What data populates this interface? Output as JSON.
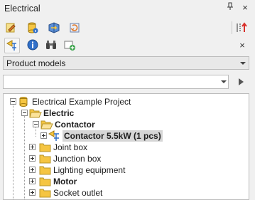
{
  "window": {
    "title": "Electrical"
  },
  "titlebar": {
    "pin_glyph": "ᵖ",
    "close_glyph": "×"
  },
  "toolbar_close": "×",
  "model_select": {
    "value": "Product models"
  },
  "search": {
    "value": "",
    "placeholder": ""
  },
  "tree": {
    "root": "Electrical Example Project",
    "electric": "Electric",
    "contactor": "Contactor",
    "contactor_item": "Contactor 5.5kW (1 pcs)",
    "joint_box": "Joint box",
    "junction_box": "Junction box",
    "lighting": "Lighting equipment",
    "motor": "Motor",
    "socket": "Socket outlet"
  },
  "colors": {
    "folder": "#f5c542",
    "folder_open": "#f7d36a",
    "accent_red": "#d9302c",
    "accent_blue": "#2f6fc9"
  }
}
